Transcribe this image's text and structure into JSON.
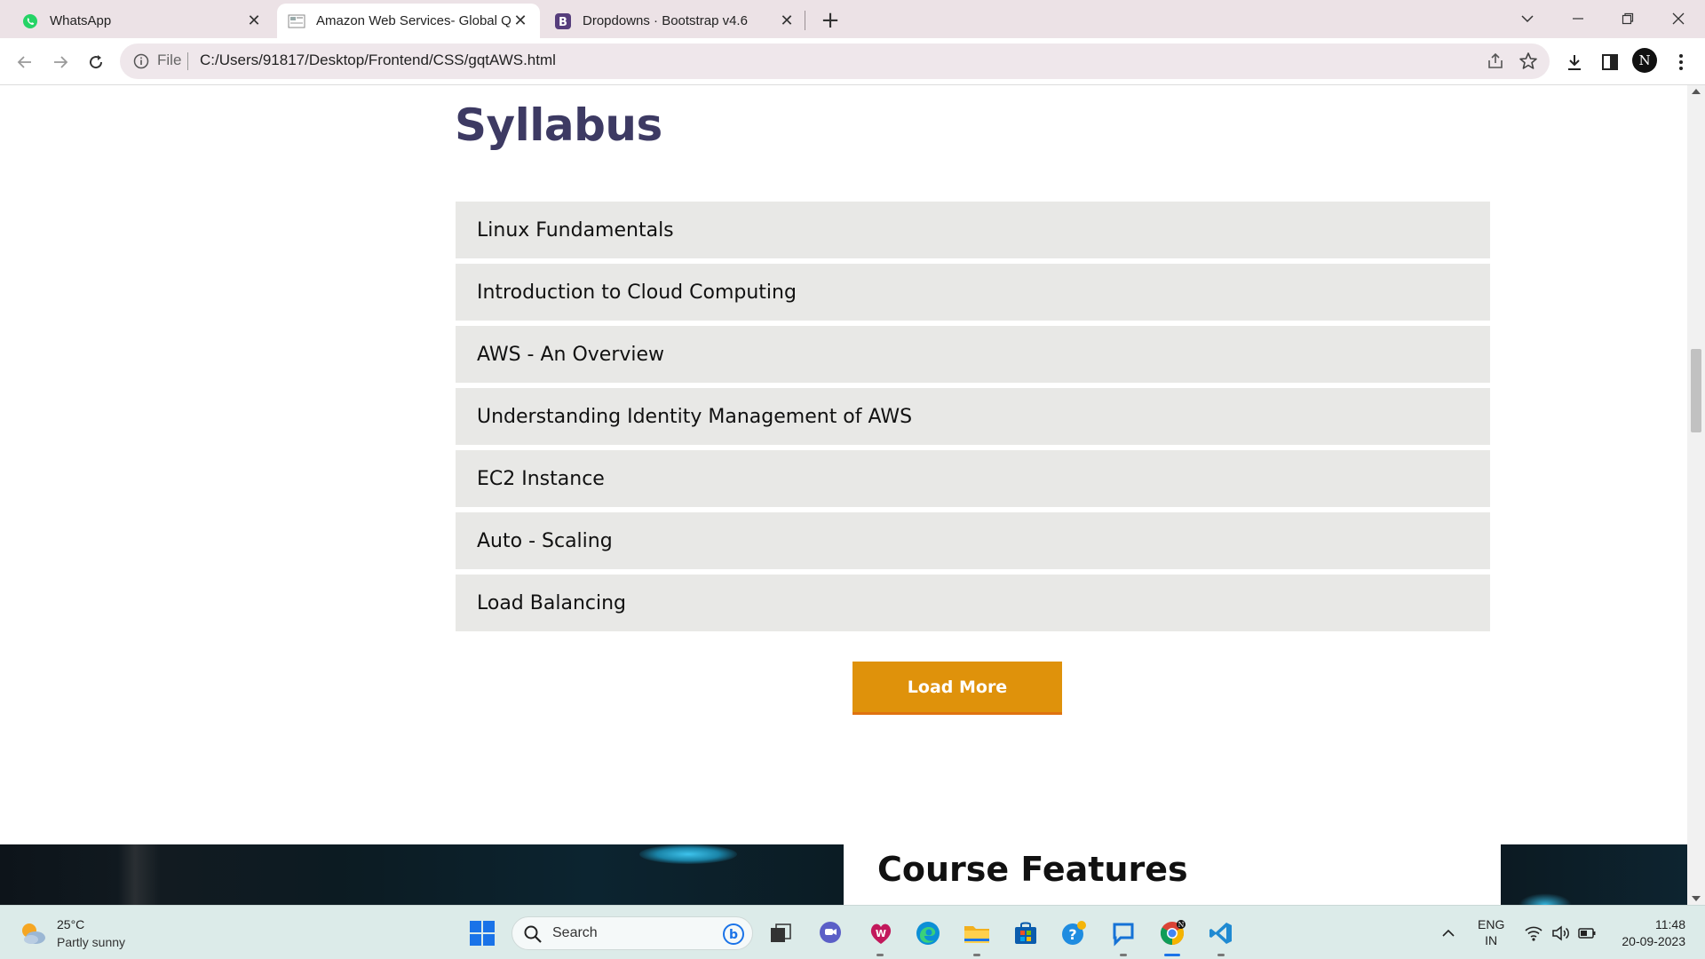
{
  "browser": {
    "tabs": [
      {
        "title": "WhatsApp",
        "icon": "whatsapp-icon",
        "active": false
      },
      {
        "title": "Amazon Web Services- Global Q",
        "icon": "page-icon",
        "active": true
      },
      {
        "title": "Dropdowns · Bootstrap v4.6",
        "icon": "bootstrap-icon",
        "active": false
      }
    ],
    "address": {
      "scheme_label": "File",
      "url": "C:/Users/91817/Desktop/Frontend/CSS/gqtAWS.html"
    },
    "profile_initial": "N"
  },
  "page": {
    "heading": "Syllabus",
    "syllabus_items": [
      "Linux Fundamentals",
      "Introduction to Cloud Computing",
      "AWS - An Overview",
      "Understanding Identity Management of AWS",
      "EC2 Instance",
      "Auto - Scaling",
      "Load Balancing"
    ],
    "load_more_label": "Load More",
    "features_title": "Course Features",
    "colors": {
      "heading": "#3d3a63",
      "item_bg": "#e8e8e6",
      "button": "#df920b"
    }
  },
  "taskbar": {
    "weather_temp": "25°C",
    "weather_desc": "Partly sunny",
    "search_placeholder": "Search",
    "lang_line1": "ENG",
    "lang_line2": "IN",
    "time": "11:48",
    "date": "20-09-2023"
  }
}
